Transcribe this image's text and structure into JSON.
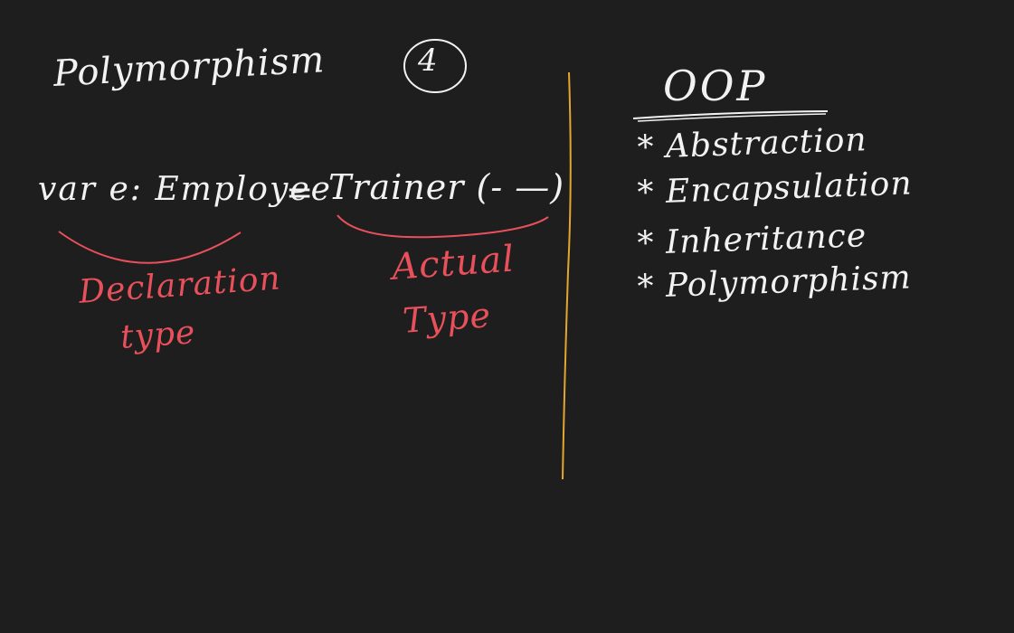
{
  "board": {
    "title": "Polymorphism",
    "page_number": "4",
    "code": {
      "left": "var  e: Employee",
      "equals": "=",
      "right": "Trainer (- —)"
    },
    "annotations": {
      "declaration_line1": "Declaration",
      "declaration_line2": "type",
      "actual_line1": "Actual",
      "actual_line2": "Type"
    },
    "oop": {
      "heading": "OOP",
      "items": [
        "* Abstraction",
        "* Encapsulation",
        "* Inheritance",
        "* Polymorphism"
      ]
    }
  },
  "colors": {
    "background": "#1e1e1e",
    "ink_white": "#f2f2f2",
    "ink_red": "#e8505b",
    "divider_orange": "#e3a72f"
  }
}
